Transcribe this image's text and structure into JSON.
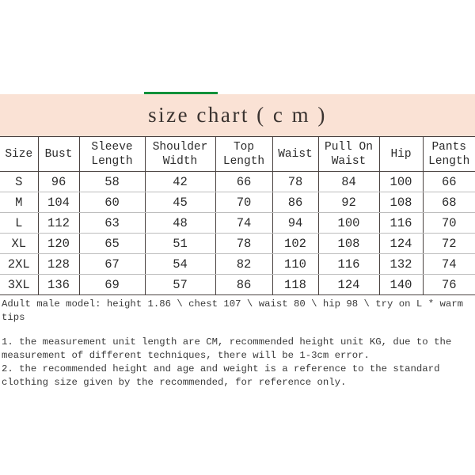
{
  "banner": {
    "title": "size chart ( c m )",
    "accent_color": "#00913A",
    "band_color": "#FAE2D5"
  },
  "table": {
    "headers": [
      "Size",
      "Bust",
      "Sleeve\nLength",
      "Shoulder\nWidth",
      "Top\nLength",
      "Waist",
      "Pull On\nWaist",
      "Hip",
      "Pants\nLength"
    ],
    "rows": [
      [
        "S",
        "96",
        "58",
        "42",
        "66",
        "78",
        "84",
        "100",
        "66"
      ],
      [
        "M",
        "104",
        "60",
        "45",
        "70",
        "86",
        "92",
        "108",
        "68"
      ],
      [
        "L",
        "112",
        "63",
        "48",
        "74",
        "94",
        "100",
        "116",
        "70"
      ],
      [
        "XL",
        "120",
        "65",
        "51",
        "78",
        "102",
        "108",
        "124",
        "72"
      ],
      [
        "2XL",
        "128",
        "67",
        "54",
        "82",
        "110",
        "116",
        "132",
        "74"
      ],
      [
        "3XL",
        "136",
        "69",
        "57",
        "86",
        "118",
        "124",
        "140",
        "76"
      ]
    ]
  },
  "notes": {
    "model": "Adult male model: height 1.86 \\ chest 107 \\ waist 80 \\ hip 98 \\ try on L * warm tips",
    "items": [
      "1. the measurement unit length are CM, recommended height unit KG, due to the measurement of different techniques, there will be 1-3cm error.",
      "2. the recommended height and age and weight is a reference to the standard clothing size given by the recommended, for reference only."
    ]
  }
}
